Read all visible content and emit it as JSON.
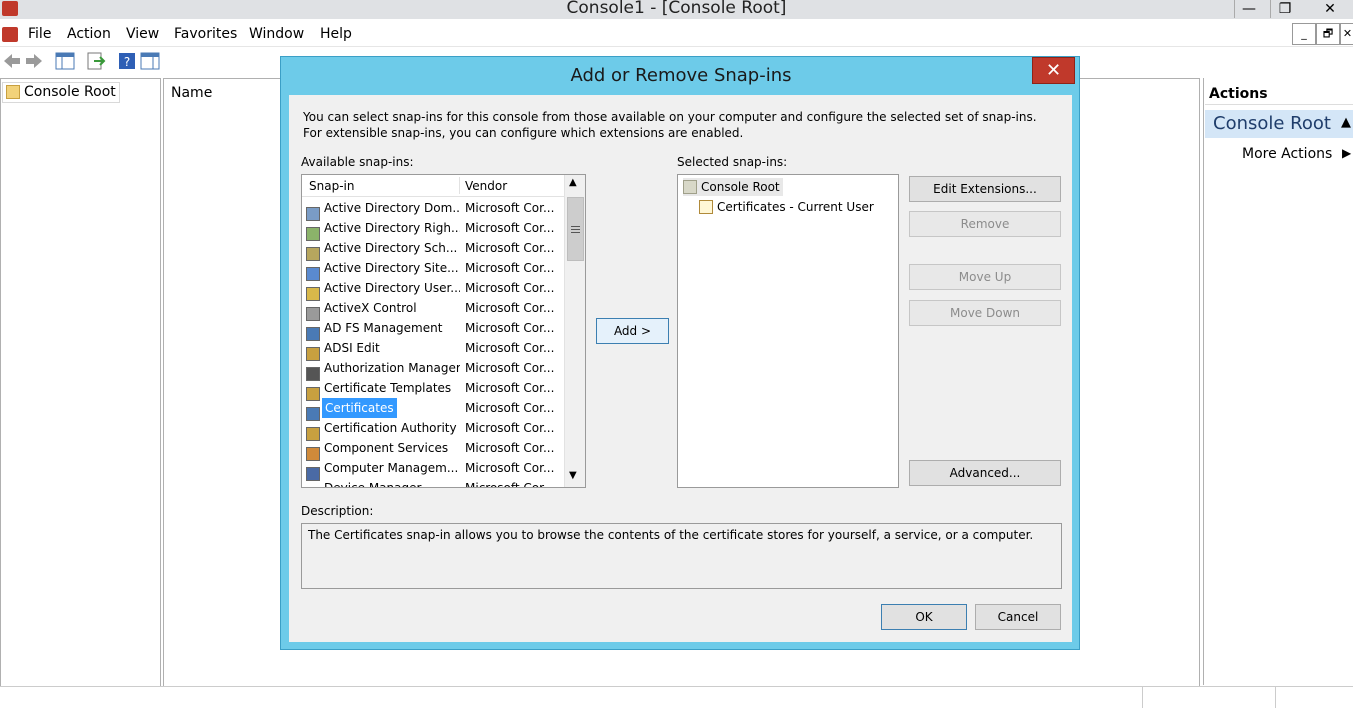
{
  "window": {
    "title": "Console1 - [Console Root]",
    "controls": {
      "minimize": "—",
      "restore": "❐",
      "close": "✕"
    },
    "mdi_controls": {
      "minimize": "_",
      "restore": "🗗",
      "close": "✕"
    }
  },
  "menu": [
    "File",
    "Action",
    "View",
    "Favorites",
    "Window",
    "Help"
  ],
  "tree": {
    "root": "Console Root"
  },
  "center": {
    "column_name": "Name"
  },
  "actions": {
    "header": "Actions",
    "section": "Console Root",
    "more": "More Actions"
  },
  "dialog": {
    "title": "Add or Remove Snap-ins",
    "close": "✕",
    "intro": "You can select snap-ins for this console from those available on your computer and configure the selected set of snap-ins. For extensible snap-ins, you can configure which extensions are enabled.",
    "available_label": "Available snap-ins:",
    "columns": {
      "snapin": "Snap-in",
      "vendor": "Vendor"
    },
    "available": [
      {
        "name": "Active Directory Dom...",
        "vendor": "Microsoft Cor...",
        "icon": "ad-domains-icon"
      },
      {
        "name": "Active Directory Righ...",
        "vendor": "Microsoft Cor...",
        "icon": "ad-rights-icon"
      },
      {
        "name": "Active Directory Sch...",
        "vendor": "Microsoft Cor...",
        "icon": "ad-schema-icon"
      },
      {
        "name": "Active Directory Site...",
        "vendor": "Microsoft Cor...",
        "icon": "ad-sites-icon"
      },
      {
        "name": "Active Directory User...",
        "vendor": "Microsoft Cor...",
        "icon": "ad-users-icon"
      },
      {
        "name": "ActiveX Control",
        "vendor": "Microsoft Cor...",
        "icon": "activex-icon"
      },
      {
        "name": "AD FS Management",
        "vendor": "Microsoft Cor...",
        "icon": "adfs-icon"
      },
      {
        "name": "ADSI Edit",
        "vendor": "Microsoft Cor...",
        "icon": "adsi-edit-icon"
      },
      {
        "name": "Authorization Manager",
        "vendor": "Microsoft Cor...",
        "icon": "authorization-icon"
      },
      {
        "name": "Certificate Templates",
        "vendor": "Microsoft Cor...",
        "icon": "cert-templates-icon"
      },
      {
        "name": "Certificates",
        "vendor": "Microsoft Cor...",
        "icon": "certificates-icon",
        "selected": true
      },
      {
        "name": "Certification Authority",
        "vendor": "Microsoft Cor...",
        "icon": "cert-authority-icon"
      },
      {
        "name": "Component Services",
        "vendor": "Microsoft Cor...",
        "icon": "component-services-icon"
      },
      {
        "name": "Computer Managem...",
        "vendor": "Microsoft Cor...",
        "icon": "computer-management-icon"
      },
      {
        "name": "Device Manager",
        "vendor": "Microsoft Cor...",
        "icon": "device-manager-icon"
      }
    ],
    "add_button": "Add >",
    "selected_label": "Selected snap-ins:",
    "selected_root": "Console Root",
    "selected_child": "Certificates - Current User",
    "buttons": {
      "edit_extensions": "Edit Extensions...",
      "remove": "Remove",
      "move_up": "Move Up",
      "move_down": "Move Down",
      "advanced": "Advanced..."
    },
    "description_label": "Description:",
    "description": "The Certificates snap-in allows you to browse the contents of the certificate stores for yourself, a service, or a computer.",
    "ok": "OK",
    "cancel": "Cancel"
  },
  "colors": {
    "dialog_frame": "#6dcbe9",
    "close_red": "#c0392b",
    "selection": "#3399ff"
  }
}
